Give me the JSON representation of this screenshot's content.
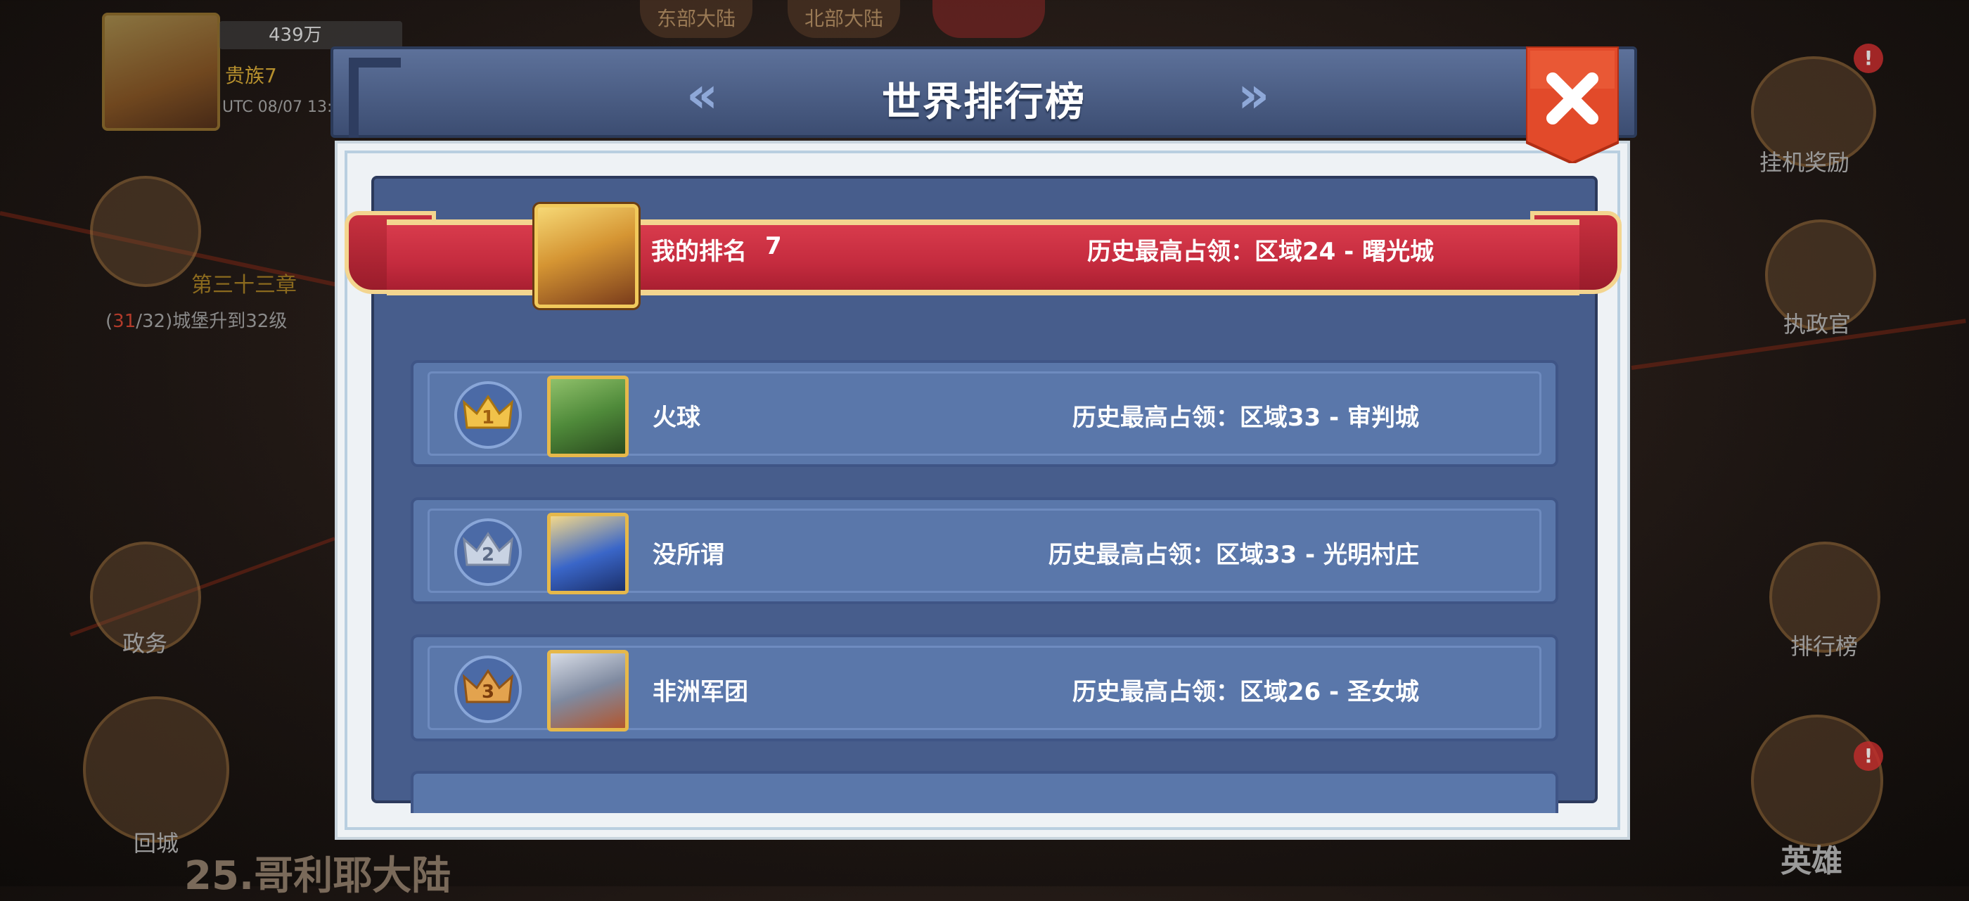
{
  "hud": {
    "power": "439万",
    "noble": "贵族7",
    "utc": "UTC 08/07 13:",
    "chapter": "第三十三章",
    "quest_prefix": "(",
    "quest_progress": "31",
    "quest_rest": "/32)城堡升到32级",
    "map_name": "25.哥利耶大陆",
    "tabs": [
      "东部大陆",
      "北部大陆"
    ],
    "left_icons": [
      "政务",
      "回城"
    ],
    "right_icons": [
      "挂机奖励",
      "执政官",
      "排行榜",
      "英雄"
    ],
    "notif_badge": "!"
  },
  "panel": {
    "title": "世界排行榜",
    "prev_arrow": "«",
    "next_arrow": "»",
    "my_rank_label": "我的排名",
    "my_rank_value": "7",
    "my_history": "历史最高占领：区域24 - 曙光城"
  },
  "rankings": [
    {
      "rank": "1",
      "name": "火球",
      "history": "历史最高占领：区域33 - 审判城",
      "crown_color": "#f1c24a",
      "avatar_color": "#4f8a3a"
    },
    {
      "rank": "2",
      "name": "没所谓",
      "history": "历史最高占领：区域33 - 光明村庄",
      "crown_color": "#c9d3e3",
      "avatar_color": "#3a66c8"
    },
    {
      "rank": "3",
      "name": "非洲军团",
      "history": "历史最高占领：区域26 - 圣女城",
      "crown_color": "#e3a34e",
      "avatar_color": "#7f8aa0"
    }
  ],
  "colors": {
    "ribbon": "#c42b3e",
    "panel_blue": "#475d8c",
    "row_blue": "#5a77aa",
    "close_red": "#e24a2a"
  }
}
